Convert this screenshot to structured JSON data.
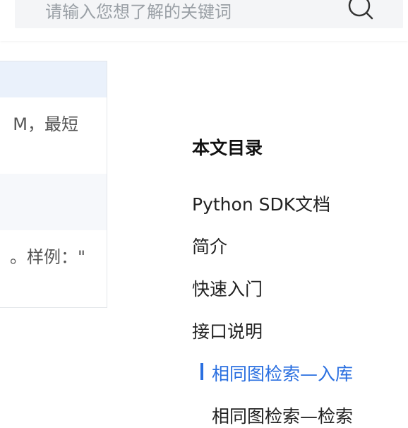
{
  "search": {
    "placeholder": "请输入您想了解的关键词"
  },
  "table": {
    "cell_1": "M，最短",
    "cell_2": "。样例：\""
  },
  "toc": {
    "title": "本文目录",
    "items": [
      {
        "label": "Python SDK文档"
      },
      {
        "label": "简介"
      },
      {
        "label": "快速入门"
      },
      {
        "label": "接口说明"
      },
      {
        "label": "相同图检索—入库"
      },
      {
        "label": "相同图检索—检索"
      }
    ]
  },
  "colors": {
    "accent": "#2a6fe0",
    "table_header_bg": "#eaf1fb"
  }
}
